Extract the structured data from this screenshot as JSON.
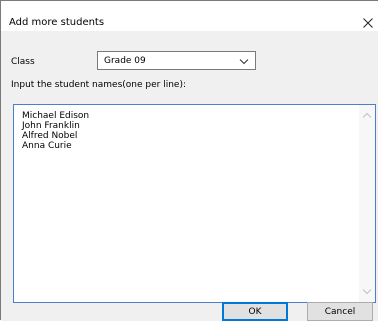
{
  "dialog": {
    "title": "Add more students",
    "close_glyph": "close-icon"
  },
  "form": {
    "class_label": "Class",
    "class_selected": "Grade 09",
    "instruction": "Input the student names(one per line):",
    "student_names": [
      "Michael Edison",
      "John Franklin",
      "Alfred Nobel",
      "Anna Curie"
    ]
  },
  "buttons": {
    "ok": "OK",
    "cancel": "Cancel"
  },
  "colors": {
    "dialog_bg": "#f0f0f0",
    "textarea_focus_border": "#4a7fd0",
    "ok_default_border": "#0078d7",
    "button_bg": "#e1e1e1"
  }
}
